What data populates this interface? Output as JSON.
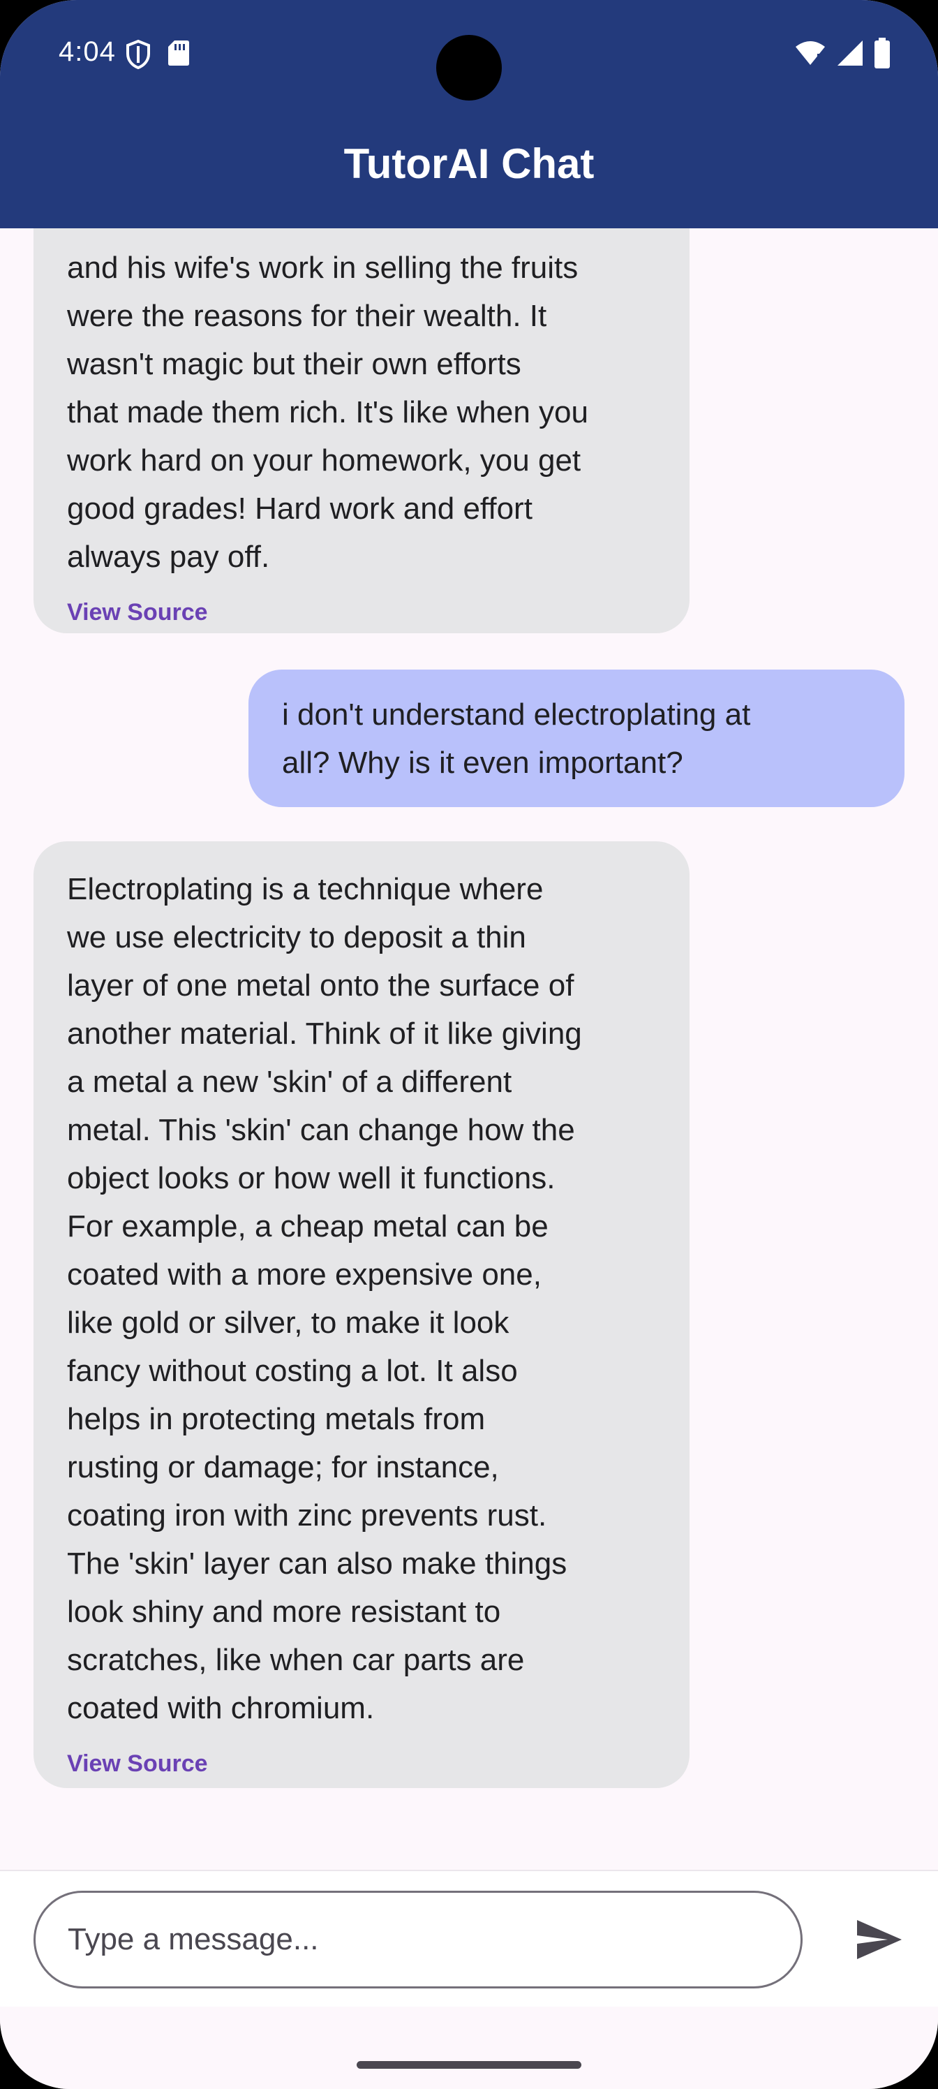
{
  "status_bar": {
    "time": "4:04",
    "left_icons": [
      "shield-icon",
      "sd-card-icon"
    ],
    "right_icons": [
      "wifi-icon",
      "cellular-signal-icon",
      "battery-icon"
    ]
  },
  "header": {
    "title": "TutorAI Chat"
  },
  "messages": [
    {
      "role": "assistant",
      "text": "and his wife's work in selling the fruits\nwere the reasons for their wealth. It\nwasn't magic but their own efforts\nthat made them rich. It's like when you\nwork hard on your homework, you get\ngood grades! Hard work and effort\nalways pay off.",
      "link": "View Source"
    },
    {
      "role": "user",
      "text": "i don't understand electroplating at\nall? Why is it even important?"
    },
    {
      "role": "assistant",
      "text": "Electroplating is a technique where\nwe use electricity to deposit a thin\nlayer of one metal onto the surface of\nanother material. Think of it like giving\na metal a new 'skin' of a different\nmetal. This 'skin' can change how the\nobject looks or how well it functions.\nFor example, a cheap metal can be\ncoated with a more expensive one,\nlike gold or silver, to make it look\nfancy without costing a lot. It also\nhelps in protecting metals from\nrusting or damage; for instance,\ncoating iron with zinc prevents rust.\nThe 'skin' layer can also make things\nlook shiny and more resistant to\nscratches, like when car parts are\ncoated with chromium.",
      "link": "View Source"
    }
  ],
  "composer": {
    "placeholder": "Type a message...",
    "value": "",
    "send_icon": "send-icon"
  },
  "colors": {
    "appbar": "#233a7c",
    "background": "#fdf7fc",
    "assistant_bubble": "#e6e6e8",
    "user_bubble": "#b9c1fb",
    "link": "#6a41b4"
  }
}
